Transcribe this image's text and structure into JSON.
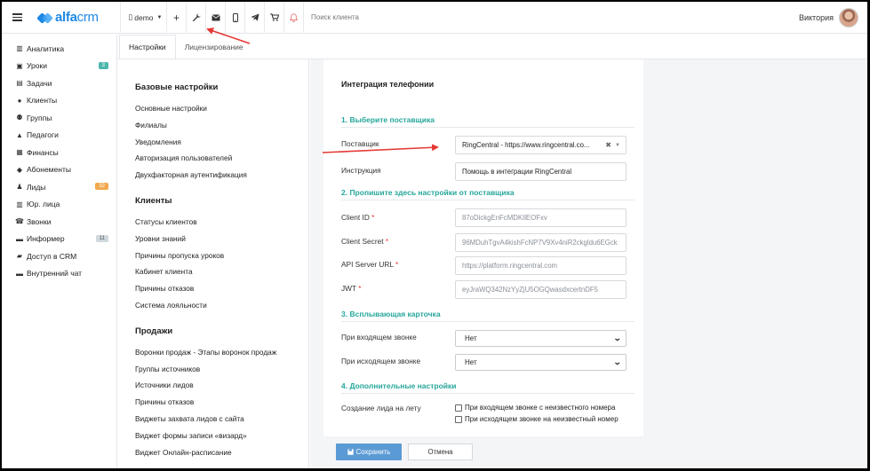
{
  "brand": {
    "name_bold": "alfa",
    "name_light": "crm"
  },
  "topbar": {
    "branch": "demo",
    "search_placeholder": "Поиск клиента",
    "user_name": "Виктория"
  },
  "sidebar": {
    "items": [
      {
        "label": "Аналитика",
        "icon": "chart-icon"
      },
      {
        "label": "Уроки",
        "icon": "calendar-icon",
        "badge": "3",
        "badge_color": "#4db6ac"
      },
      {
        "label": "Задачи",
        "icon": "tasks-icon"
      },
      {
        "label": "Клиенты",
        "icon": "client-icon"
      },
      {
        "label": "Группы",
        "icon": "groups-icon"
      },
      {
        "label": "Педагоги",
        "icon": "teacher-icon"
      },
      {
        "label": "Финансы",
        "icon": "finance-icon"
      },
      {
        "label": "Абонементы",
        "icon": "tag-icon"
      },
      {
        "label": "Лиды",
        "icon": "lead-icon",
        "badge": "32",
        "badge_color": "#f0a94e"
      },
      {
        "label": "Юр. лица",
        "icon": "building-icon"
      },
      {
        "label": "Звонки",
        "icon": "phone-icon"
      },
      {
        "label": "Информер",
        "icon": "inbox-icon",
        "badge": "11",
        "badge_color": "#cfd8dc"
      },
      {
        "label": "Доступ в CRM",
        "icon": "lock-icon"
      },
      {
        "label": "Внутренний чат",
        "icon": "chat-icon"
      }
    ]
  },
  "tabs": [
    "Настройки",
    "Лицензирование"
  ],
  "settings_nav": {
    "sections": [
      {
        "title": "Базовые настройки",
        "links": [
          "Основные настройки",
          "Филиалы",
          "Уведомления",
          "Авторизация пользователей",
          "Двухфакторная аутентификация"
        ]
      },
      {
        "title": "Клиенты",
        "links": [
          "Статусы клиентов",
          "Уровни знаний",
          "Причины пропуска уроков",
          "Кабинет клиента",
          "Причины отказов",
          "Система лояльности"
        ]
      },
      {
        "title": "Продажи",
        "links": [
          "Воронки продаж - Этапы воронок продаж",
          "Группы источников",
          "Источники лидов",
          "Причины отказов",
          "Виджеты захвата лидов с сайта",
          "Виджет формы записи «визард»",
          "Виджет Онлайн-расписание"
        ]
      }
    ]
  },
  "form": {
    "title": "Интеграция телефонии",
    "section1": "1. Выберите поставщика",
    "provider_label": "Поставщик",
    "provider_value": "RingCentral - https://www.ringcentral.co...",
    "instruction_label": "Инструкция",
    "instruction_value": "Помощь в интеграции RingCentral",
    "section2": "2. Пропишите здесь настройки от поставщика",
    "client_id_label": "Client ID",
    "client_id_value": "87oDickgEnFcMDKIlEOFxv",
    "client_secret_label": "Client Secret",
    "client_secret_value": "96MDuhTgvA4kishFcNP7V9Xv4niR2ckgldu6EGck",
    "api_url_label": "API Server URL",
    "api_url_value": "https://platform.ringcentral.com",
    "jwt_label": "JWT",
    "jwt_value": "eyJraWQ342NzYyZjU5OGQwasdxcertnDF5",
    "required_mark": "*",
    "section3": "3. Всплывающая карточка",
    "incoming_label": "При входящем звонке",
    "incoming_value": "Нет",
    "outgoing_label": "При исходящем звонке",
    "outgoing_value": "Нет",
    "section4": "4. Дополнительные настройки",
    "lead_label": "Создание лида на лету",
    "lead_opt1": "При входящем звонке с неизвестного номера",
    "lead_opt2": "При исходящем звонке на неизвестный номер",
    "save_label": "Сохранить",
    "cancel_label": "Отмена"
  },
  "colors": {
    "accent": "#1e88e5",
    "section": "#26a69a",
    "save": "#5b9bd5",
    "annotation": "#e53935"
  }
}
